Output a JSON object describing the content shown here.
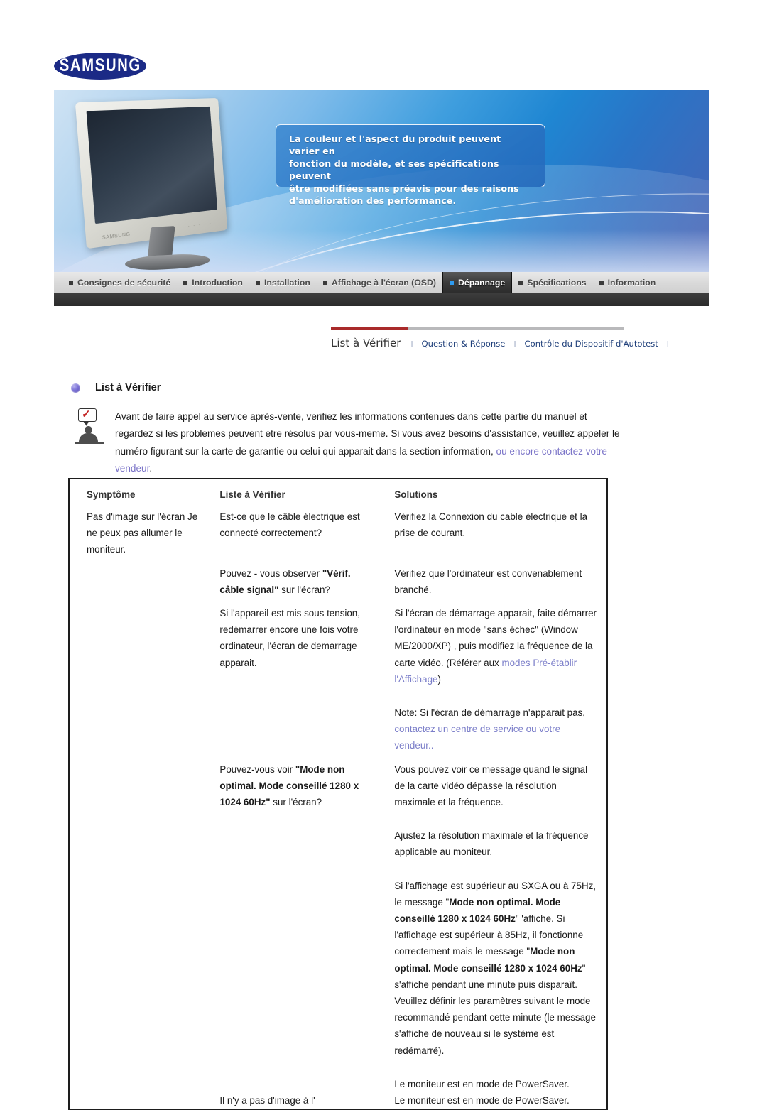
{
  "brand": {
    "logo_text": "SAMSUNG"
  },
  "banner": {
    "callout_lines": [
      "La couleur et l'aspect du produit peuvent varier en",
      "fonction du modèle, et ses spécifications peuvent",
      "être modifiées sans préavis pour des raisons",
      "d'amélioration des performance."
    ],
    "monitor_brand": "SAMSUNG",
    "monitor_buttons": "- - - - - -"
  },
  "main_nav": {
    "items": [
      {
        "label": "Consignes de sécurité",
        "active": false
      },
      {
        "label": "Introduction",
        "active": false
      },
      {
        "label": "Installation",
        "active": false
      },
      {
        "label": "Affichage à l'écran (OSD)",
        "active": false
      },
      {
        "label": "Dépannage",
        "active": true
      },
      {
        "label": "Spécifications",
        "active": false
      },
      {
        "label": "Information",
        "active": false
      }
    ]
  },
  "sub_nav": {
    "primary": "List à Vérifier",
    "separator": "l",
    "items": [
      "Question & Réponse",
      "Contrôle du Dispositif d'Autotest"
    ]
  },
  "section": {
    "title": "List à Vérifier"
  },
  "intro": {
    "part1": "Avant de faire appel au service après-vente, verifiez les informations contenues dans cette partie du manuel et regardez si les problemes peuvent etre résolus par vous-meme. Si vous avez besoins d'assistance, veuillez appeler le numéro figurant sur la carte de garantie ou celui qui apparait dans la section information,",
    "link": " ou encore contactez votre vendeur",
    "part2": "."
  },
  "table": {
    "headers": [
      "Symptôme",
      "Liste à Vérifier",
      "Solutions"
    ],
    "rows": [
      {
        "symptom": "Pas d'image sur l'écran Je ne peux pas allumer le moniteur.",
        "checks": [
          {
            "plain": "Est-ce que le câble électrique est connecté correctement?"
          },
          {
            "pre": "Pouvez - vous observer ",
            "bold": "\"Vérif. câble signal\"",
            "post": " sur l'écran?"
          },
          {
            "plain": "Si l'appareil est mis sous tension, redémarrer encore une fois votre ordinateur, l'écran de demarrage apparait."
          },
          {
            "pre": "Pouvez-vous voir ",
            "bold": "\"Mode non optimal. Mode conseillé 1280 x 1024 60Hz\"",
            "post": " sur l'écran?"
          },
          {
            "plain": "Il n'y a pas d'image à l'"
          }
        ],
        "solutions": [
          {
            "plain": "Vérifiez la Connexion du cable électrique et la prise de courant."
          },
          {
            "plain": "Vérifiez que l'ordinateur est convenablement branché."
          },
          {
            "pre": "Si l'écran de démarrage apparait, faite démarrer l'ordinateur en mode \"sans échec\" (Window ME/2000/XP) , puis modifiez la fréquence de la carte vidéo.\n(Référer aux ",
            "link": "modes Pré-établir l'Affichage",
            "post": ")"
          },
          {
            "pre": "Note: Si l'écran de démarrage n'apparait pas, ",
            "link": "contactez un centre de service ou votre vendeur..",
            "post": ""
          },
          {
            "plain": "Vous pouvez voir ce message quand le signal de la carte vidéo dépasse la résolution maximale et la fréquence."
          },
          {
            "plain": "Ajustez la résolution maximale et la fréquence applicable au moniteur."
          },
          {
            "pre": "Si l'affichage est supérieur au SXGA ou à 75Hz, le message \"",
            "bold": "Mode non optimal. Mode conseillé 1280 x 1024 60Hz",
            "post": "\" 'affiche."
          },
          {
            "pre": "Si l'affichage est supérieur à 85Hz, il fonctionne correctement mais le message \"",
            "bold": "Mode non optimal. Mode conseillé 1280 x 1024 60Hz",
            "post": "\" s'affiche pendant une minute puis disparaît. Veuillez définir les paramètres suivant le mode recommandé pendant cette minute (le message s'affiche de nouveau si le système est redémarré)."
          },
          {
            "plain": "Le moniteur est en mode de PowerSaver."
          }
        ]
      }
    ]
  }
}
